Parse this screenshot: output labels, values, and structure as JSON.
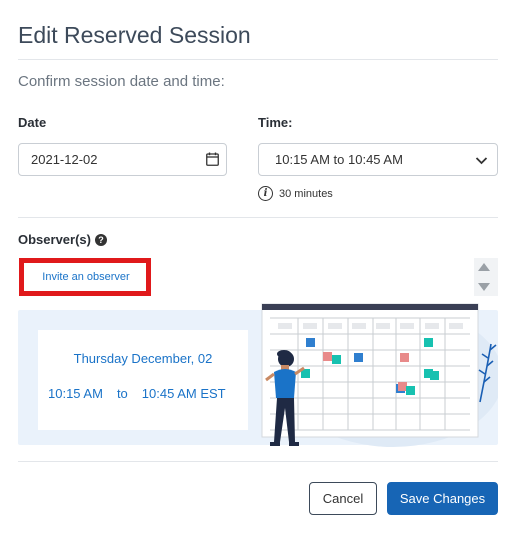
{
  "dialog": {
    "title": "Edit Reserved Session",
    "subtitle": "Confirm session date and time:"
  },
  "date": {
    "label": "Date",
    "value": "2021-12-02"
  },
  "time": {
    "label": "Time:",
    "value": "10:15 AM to 10:45 AM",
    "duration": "30 minutes"
  },
  "observers": {
    "label": "Observer(s)",
    "invite_label": "Invite an observer",
    "highlight_color": "#e0191b"
  },
  "summary": {
    "date_text": "Thursday December, 02",
    "start_time": "10:15 AM",
    "separator": "to",
    "end_time": "10:45 AM EST"
  },
  "footer": {
    "cancel_label": "Cancel",
    "save_label": "Save Changes"
  },
  "colors": {
    "primary": "#1765b5",
    "link": "#1a73c8",
    "panel_bg": "#eaf2fb"
  }
}
